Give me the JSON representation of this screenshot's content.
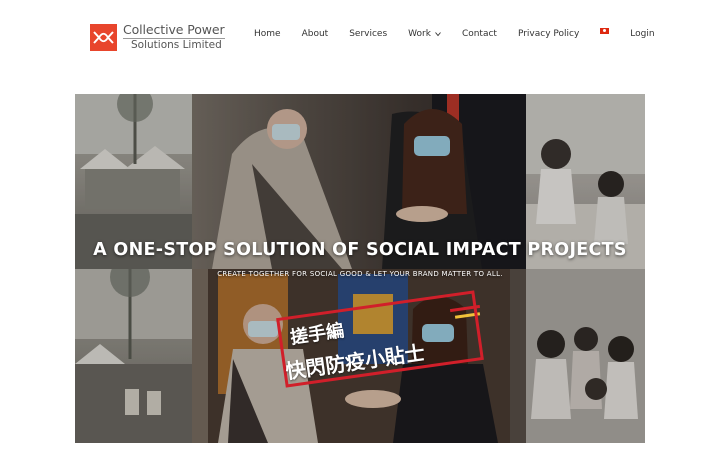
{
  "brand": {
    "name_line1": "Collective Power",
    "name_line2": "Solutions Limited",
    "logo_color": "#e8452c"
  },
  "nav": {
    "items": [
      {
        "label": "Home"
      },
      {
        "label": "About"
      },
      {
        "label": "Services"
      },
      {
        "label": "Work",
        "has_dropdown": true
      },
      {
        "label": "Contact"
      },
      {
        "label": "Privacy Policy"
      }
    ],
    "language_flag": "hong-kong-flag-icon",
    "login_label": "Login"
  },
  "hero": {
    "title": "A ONE-STOP SOLUTION OF SOCIAL IMPACT PROJECTS",
    "subtitle": "CREATE TOGETHER FOR SOCIAL GOOD & LET YOUR BRAND MATTER TO ALL.",
    "overlay_caption_line1": "搓手編",
    "overlay_caption_line2": "快閃防疫小貼士",
    "accent_color": "#d11f2a"
  }
}
